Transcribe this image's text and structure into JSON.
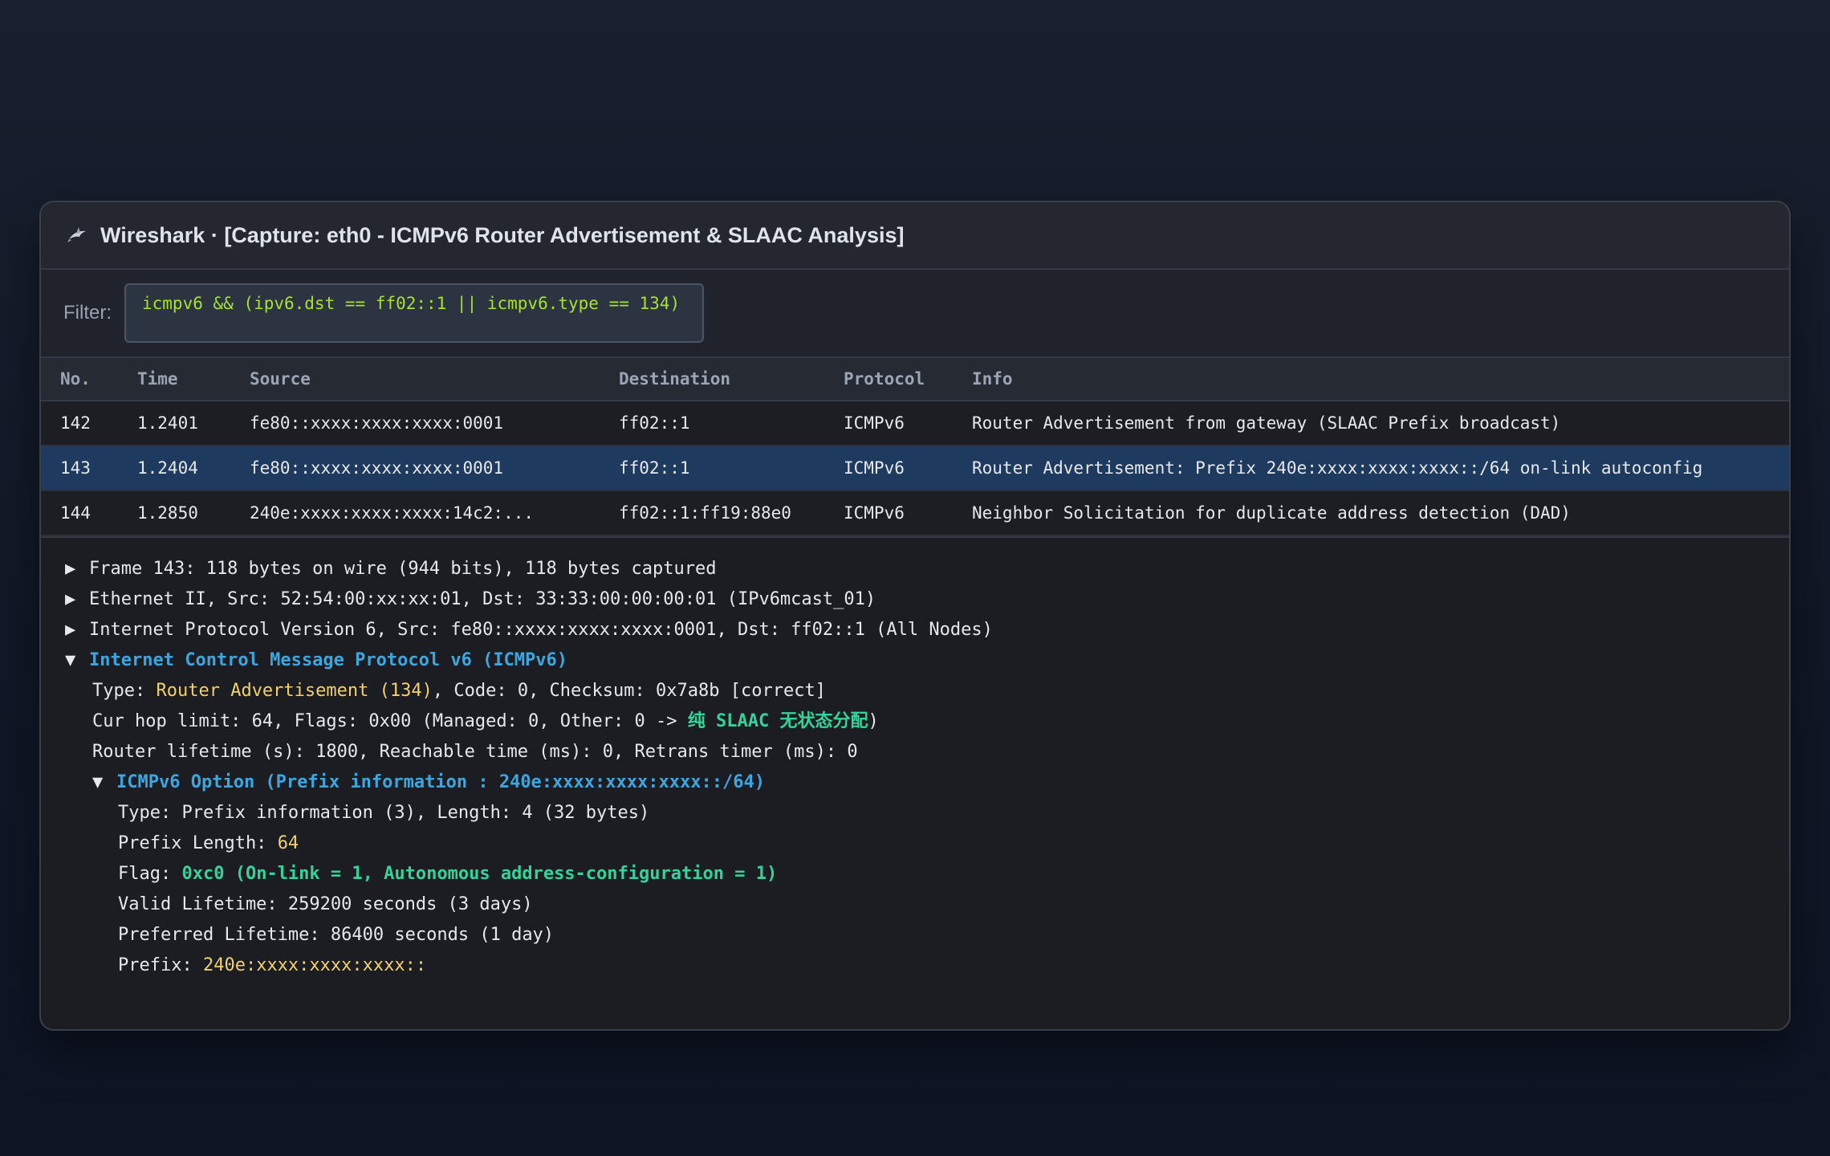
{
  "window": {
    "title": "Wireshark · [Capture: eth0 - ICMPv6 Router Advertisement & SLAAC Analysis]",
    "icon": "shark-icon"
  },
  "filter": {
    "label": "Filter:",
    "value": "icmpv6 && (ipv6.dst == ff02::1 || icmpv6.type == 134)"
  },
  "packet_list": {
    "columns": [
      "No.",
      "Time",
      "Source",
      "Destination",
      "Protocol",
      "Info"
    ],
    "rows": [
      {
        "no": "142",
        "time": "1.2401",
        "source": "fe80::xxxx:xxxx:xxxx:0001",
        "destination": "ff02::1",
        "protocol": "ICMPv6",
        "info": "Router Advertisement from gateway (SLAAC Prefix broadcast)"
      },
      {
        "no": "143",
        "time": "1.2404",
        "source": "fe80::xxxx:xxxx:xxxx:0001",
        "destination": "ff02::1",
        "protocol": "ICMPv6",
        "info": "Router Advertisement: Prefix 240e:xxxx:xxxx:xxxx::/64 on-link autoconfig",
        "selected": true
      },
      {
        "no": "144",
        "time": "1.2850",
        "source": "240e:xxxx:xxxx:xxxx:14c2:...",
        "destination": "ff02::1:ff19:88e0",
        "protocol": "ICMPv6",
        "info": "Neighbor Solicitation for duplicate address detection (DAD)"
      }
    ]
  },
  "details": {
    "frame": "Frame 143: 118 bytes on wire (944 bits), 118 bytes captured",
    "ethernet": "Ethernet II, Src: 52:54:00:xx:xx:01, Dst: 33:33:00:00:00:01 (IPv6mcast_01)",
    "ipv6": "Internet Protocol Version 6, Src: fe80::xxxx:xxxx:xxxx:0001, Dst: ff02::1 (All Nodes)",
    "icmpv6_header": "Internet Control Message Protocol v6 (ICMPv6)",
    "type_prefix": "Type: ",
    "type_value": "Router Advertisement (134)",
    "type_suffix": ", Code: 0, Checksum: 0x7a8b [correct]",
    "hop_prefix": "Cur hop limit: 64, Flags: 0x00 (Managed: 0, Other: 0 -> ",
    "hop_highlight": "纯 SLAAC 无状态分配",
    "hop_suffix": ")",
    "lifetime": "Router lifetime (s): 1800, Reachable time (ms): 0, Retrans timer (ms): 0",
    "option_header": "ICMPv6 Option (Prefix information : 240e:xxxx:xxxx:xxxx::/64)",
    "opt_type": "Type: Prefix information (3), Length: 4 (32 bytes)",
    "prefix_len_label": "Prefix Length: ",
    "prefix_len_value": "64",
    "flag_label": "Flag: ",
    "flag_value": "0xc0 (On-link = 1, Autonomous address-configuration = 1)",
    "valid_lifetime": "Valid Lifetime: 259200 seconds (3 days)",
    "preferred_lifetime": "Preferred Lifetime: 86400 seconds (1 day)",
    "prefix_label": "Prefix: ",
    "prefix_value": "240e:xxxx:xxxx:xxxx::",
    "collapsed_arrow": "▶",
    "expanded_arrow": "▼"
  }
}
